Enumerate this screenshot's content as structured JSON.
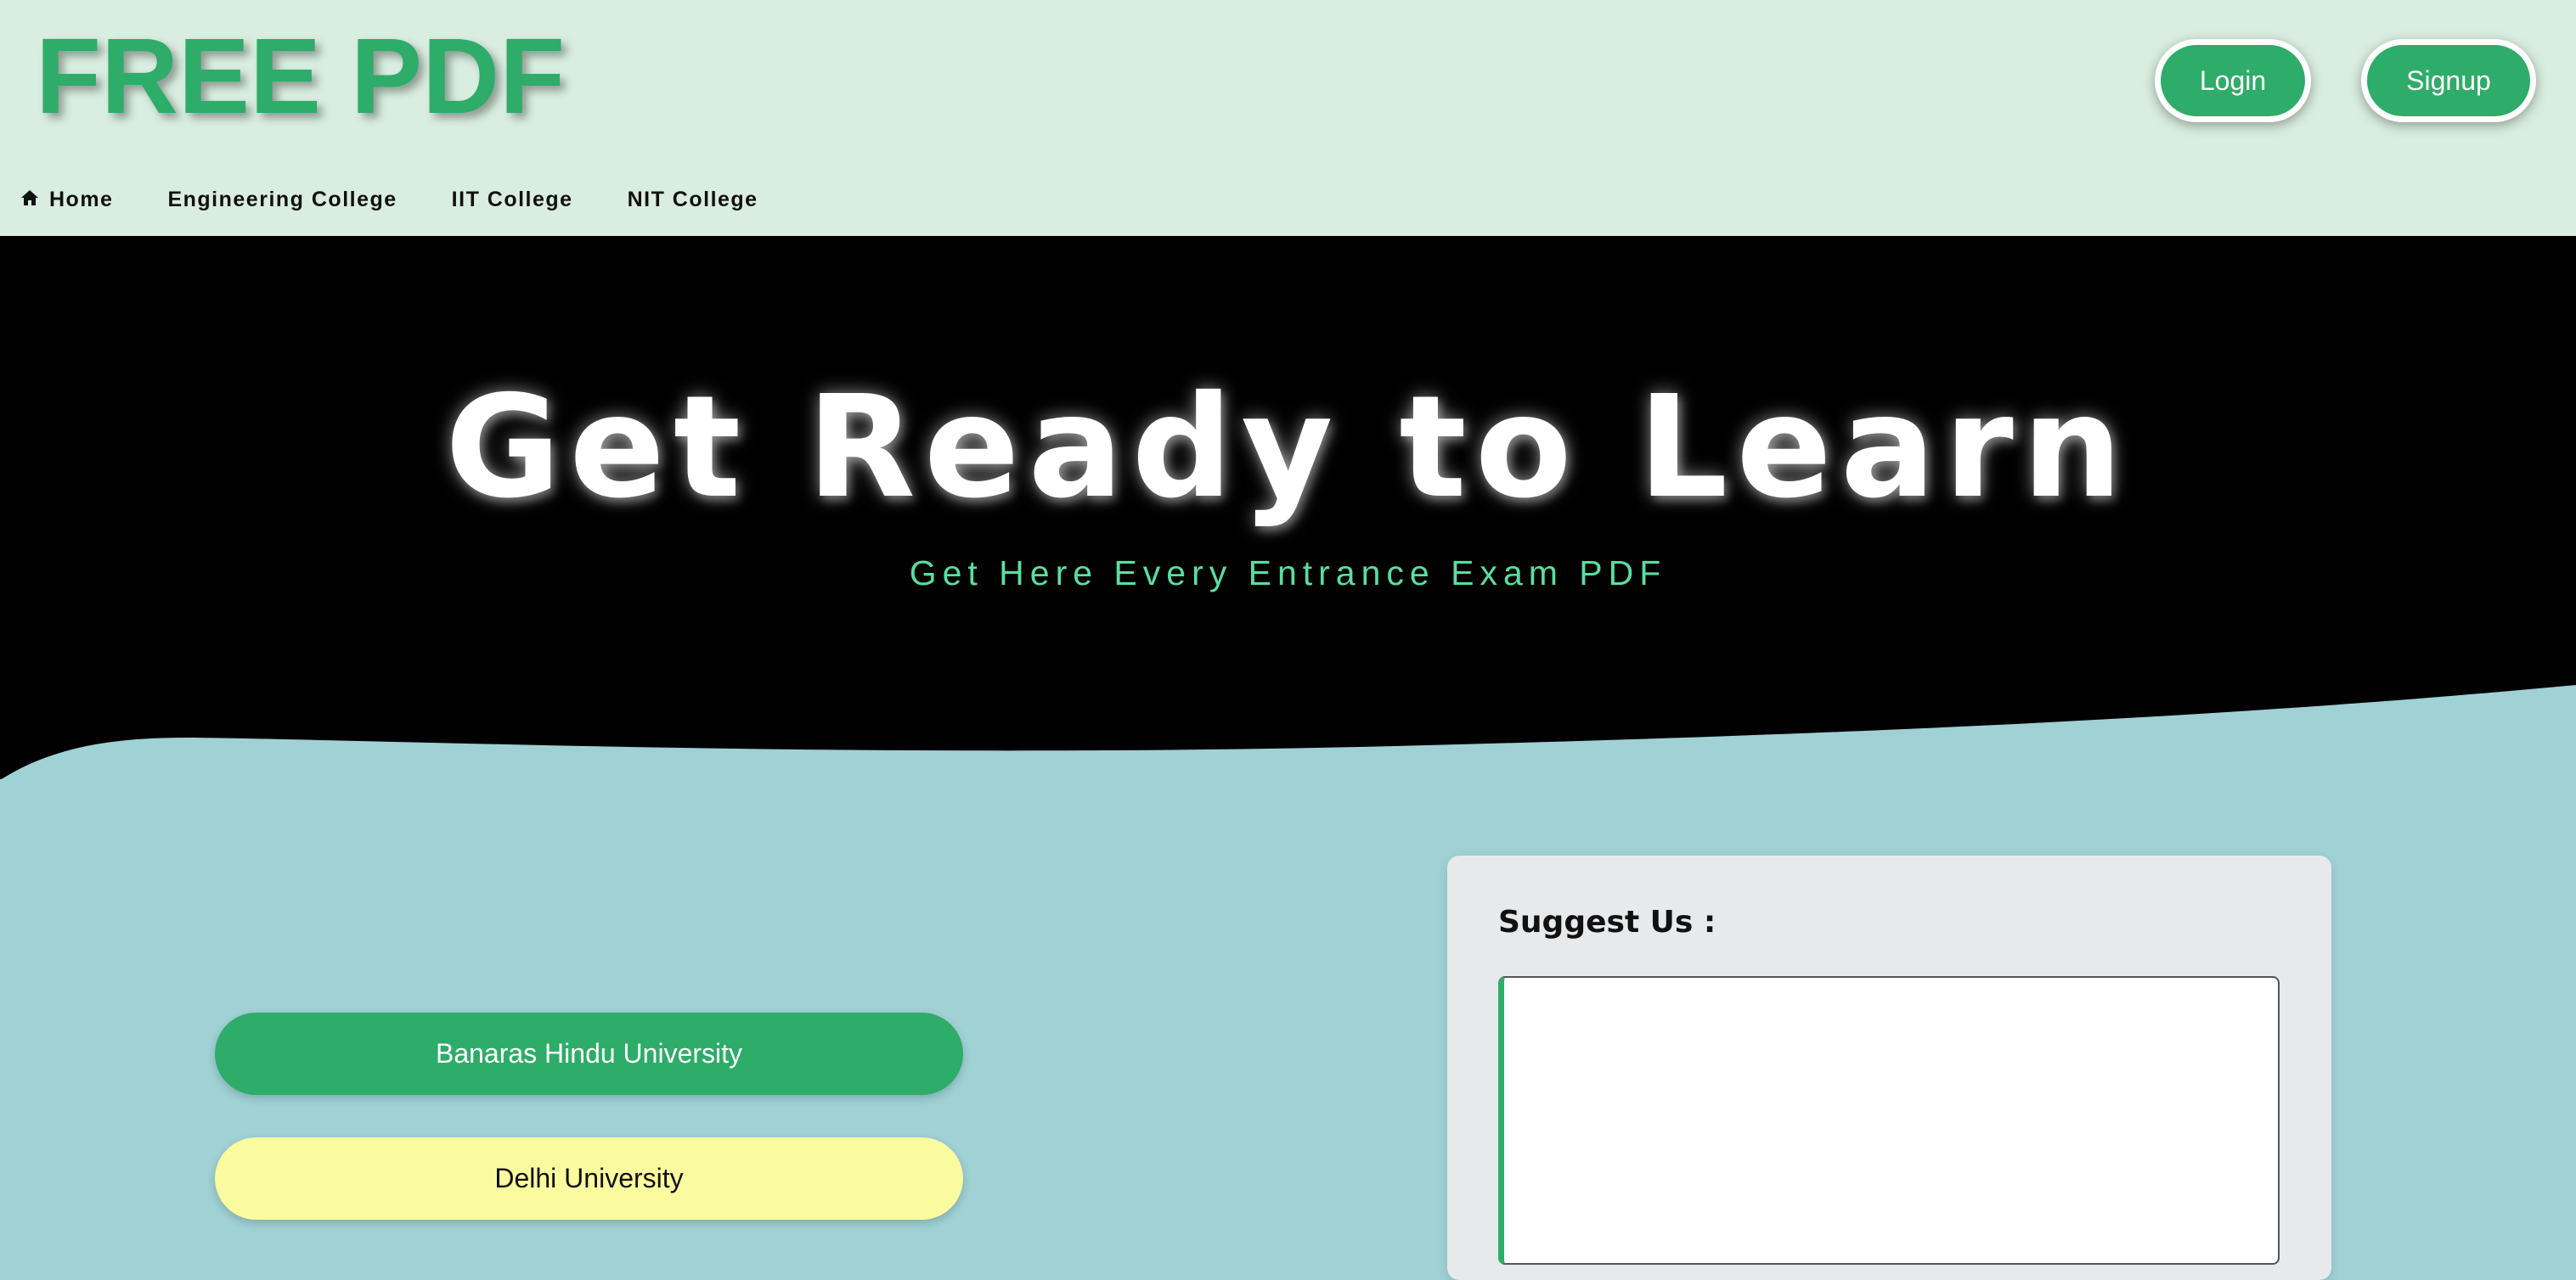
{
  "header": {
    "logo": "FREE PDF",
    "login_label": "Login",
    "signup_label": "Signup"
  },
  "nav": {
    "items": [
      {
        "label": "Home",
        "icon": "home-icon"
      },
      {
        "label": "Engineering College"
      },
      {
        "label": "IIT College"
      },
      {
        "label": "NIT College"
      }
    ]
  },
  "hero": {
    "title": "Get Ready to Learn",
    "subtitle": "Get Here Every Entrance Exam PDF"
  },
  "universities": [
    {
      "label": "Banaras Hindu University"
    },
    {
      "label": "Delhi University"
    }
  ],
  "suggest": {
    "title": "Suggest Us :",
    "value": ""
  },
  "colors": {
    "brand_green": "#2eac69",
    "header_bg": "#d9eee0",
    "hero_bg": "#000000",
    "page_bg": "#9fd1d5",
    "accent_mint": "#59dfa0",
    "yellow": "#fafa9e"
  }
}
